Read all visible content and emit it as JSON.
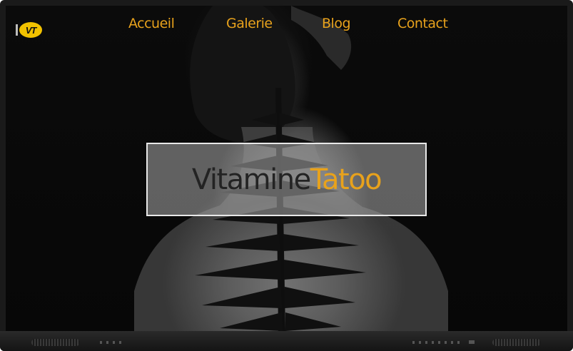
{
  "logo": {
    "text": "VT",
    "brand_color": "#f2c200"
  },
  "nav": {
    "items": [
      {
        "label": "Accueil"
      },
      {
        "label": "Galerie"
      },
      {
        "label": "Blog"
      },
      {
        "label": "Contact"
      }
    ],
    "color": "#e8a21c"
  },
  "hero": {
    "title_part1": "Vitamine",
    "title_part2": "Tatoo",
    "title_part2_color": "#e8a21c"
  }
}
